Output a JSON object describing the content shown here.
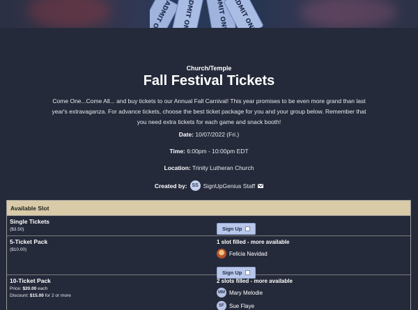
{
  "page": {
    "category": "Church/Temple",
    "title": "Fall Festival Tickets",
    "description": "Come One...Come All... and buy tickets to our Annual Fall Carnival! This year promises to be even more grand than last year's extravaganza. For advance tickets, choose the best ticket package for you and your group below. Remember that you need extra tickets for each game and snack booth!"
  },
  "banner": {
    "ticket_texts": [
      "ADMIT ONE",
      "ADMIT ONE",
      "ADMIT ONE",
      "ADMIT ONE"
    ]
  },
  "details": {
    "date_label": "Date:",
    "date_value": "10/07/2022 (Fri.)",
    "time_label": "Time:",
    "time_value": "6:00pm - 10:00pm EDT",
    "location_label": "Location:",
    "location_value": "Trinity Lutheran Church",
    "created_label": "Created by:",
    "creator_initials": "SS",
    "creator_name": "SignUpGenius Staff",
    "mail_icon": "envelope-icon"
  },
  "table": {
    "header": "Available Slot",
    "rows": [
      {
        "name": "Single Tickets",
        "price_text": "($3.50)",
        "signup_label": "Sign Up"
      },
      {
        "name": "5-Ticket Pack",
        "price_text": "($10.00)",
        "status": "1 slot filled - more available",
        "participants": [
          {
            "name": "Felicia Navidad",
            "initials": ""
          }
        ],
        "signup_label": "Sign Up"
      },
      {
        "name": "10-Ticket Pack",
        "price_label": "Price:",
        "price_value": "$20.00",
        "price_suffix": "each",
        "discount_label": "Discount:",
        "discount_value": "$15.00",
        "discount_suffix": "for 2 or more",
        "status": "2 slots filled - more available",
        "participants": [
          {
            "name": "Mary Melodie",
            "initials": "MM"
          },
          {
            "name": "Sue Flaye",
            "initials": "SF"
          }
        ]
      }
    ]
  },
  "colors": {
    "background": "#252a3a",
    "table_header": "#d9cba8",
    "button": "#b8c7ea",
    "ticket": "#9fb3dd"
  }
}
